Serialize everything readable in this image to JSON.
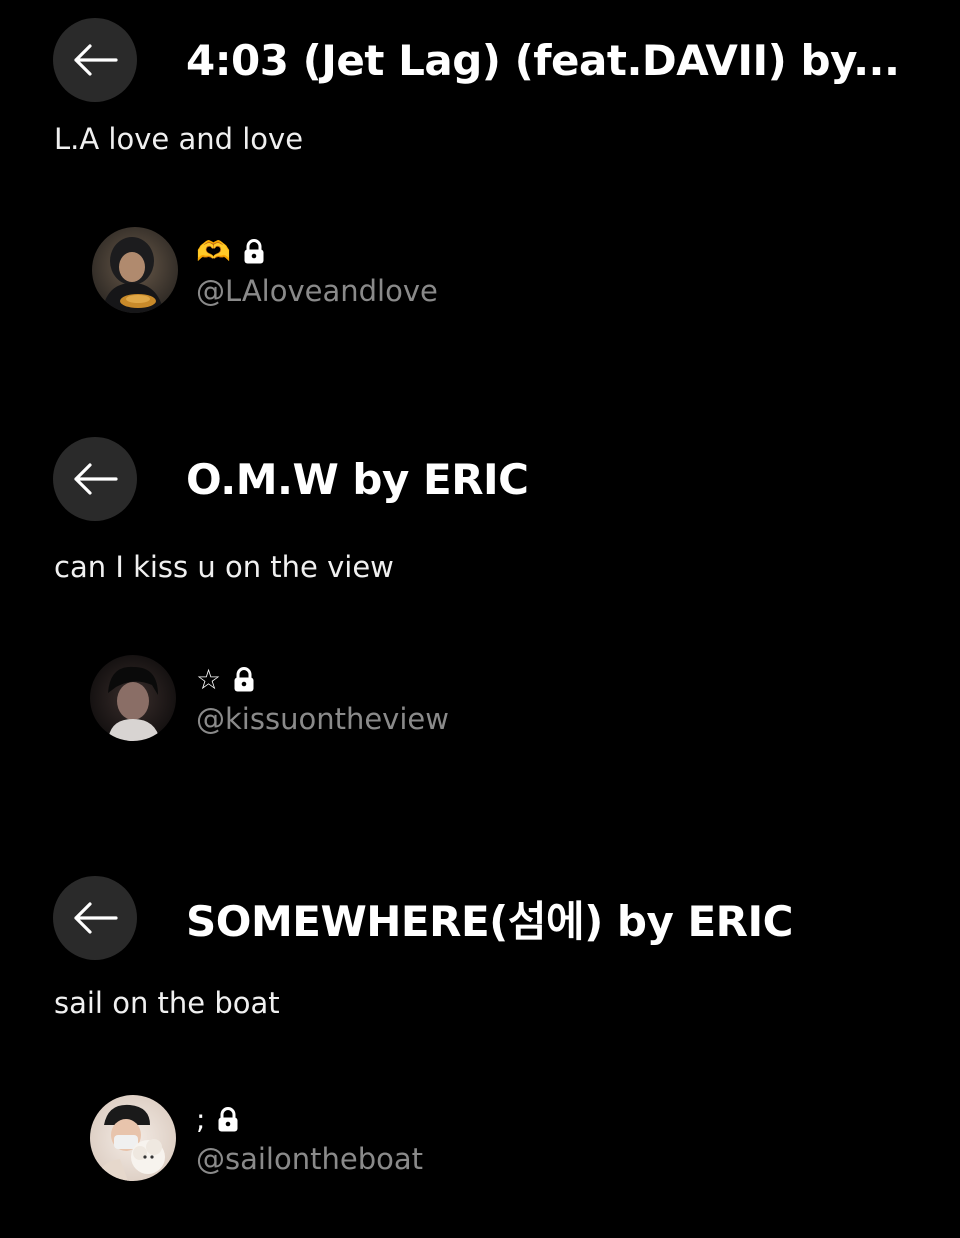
{
  "posts": [
    {
      "title": "4:03 (Jet Lag) (feat.DAVII) by...",
      "caption": "L.A love and love",
      "profile": {
        "display_name": "🫶",
        "lock_icon": "lock-icon",
        "handle": "@LAloveandlove"
      }
    },
    {
      "title": "O.M.W by ERIC",
      "caption": "can I kiss u on the view",
      "profile": {
        "display_name": "☆",
        "lock_icon": "lock-icon",
        "handle": "@kissuontheview"
      }
    },
    {
      "title": "SOMEWHERE(섬에) by ERIC",
      "caption": "sail on the boat",
      "profile": {
        "display_name": ";",
        "lock_icon": "lock-icon",
        "handle": "@sailontheboat"
      }
    }
  ],
  "icons": {
    "back": "arrow-left-icon",
    "lock": "lock-icon"
  },
  "colors": {
    "background": "#000000",
    "button_bg": "#2a2a2a",
    "handle": "#8a8a8a"
  }
}
